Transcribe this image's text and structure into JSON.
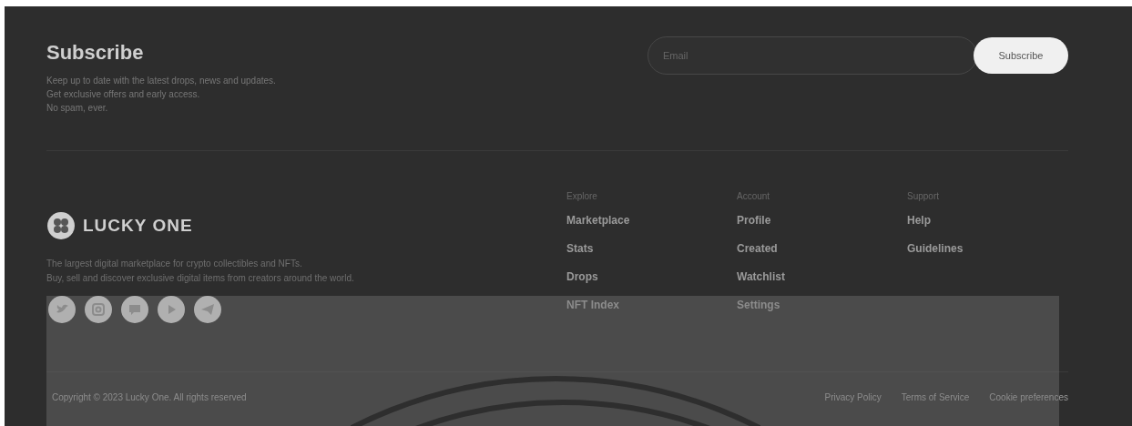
{
  "subscribe": {
    "title": "Subscribe",
    "description": [
      "Keep up to date with the latest drops, news and updates.",
      "Get exclusive offers and early access.",
      "No spam, ever."
    ],
    "email": {
      "placeholder": "Email"
    },
    "button": "Subscribe"
  },
  "brand": {
    "name": "LUCKY ONE",
    "description": [
      "The largest digital marketplace for crypto collectibles and NFTs.",
      "Buy, sell and discover exclusive digital items from creators around the world."
    ],
    "socials": [
      {
        "kind": "bird"
      },
      {
        "kind": "camera"
      },
      {
        "kind": "chat"
      },
      {
        "kind": "play"
      },
      {
        "kind": "plane"
      }
    ]
  },
  "columns": [
    {
      "heading": "Explore",
      "items": [
        "Marketplace",
        "Stats",
        "Drops",
        "NFT Index"
      ]
    },
    {
      "heading": "Account",
      "items": [
        "Profile",
        "Created",
        "Watchlist",
        "Settings"
      ]
    },
    {
      "heading": "Support",
      "items": [
        "Help",
        "Guidelines"
      ]
    }
  ],
  "bottom": {
    "copyright": "Copyright © 2023 Lucky One. All rights reserved",
    "links": [
      "Privacy Policy",
      "Terms of Service",
      "Cookie preferences"
    ]
  }
}
